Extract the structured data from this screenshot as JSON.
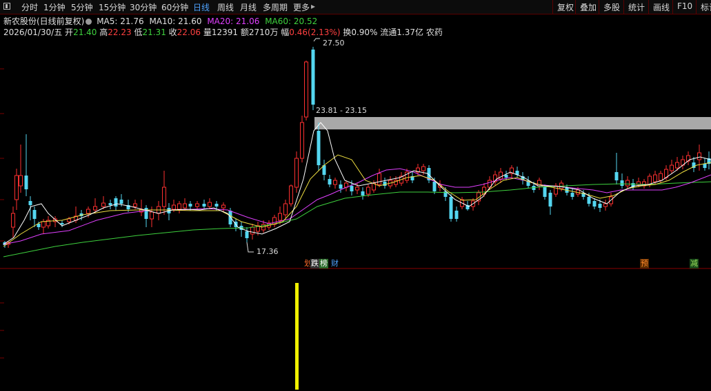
{
  "toolbar": {
    "menu_icon": "panel-toggle-icon",
    "periods": [
      "分时",
      "1分钟",
      "5分钟",
      "15分钟",
      "30分钟",
      "60分钟",
      "日线",
      "周线",
      "月线",
      "多周期",
      "更多"
    ],
    "active_period": "日线",
    "more_arrow": "▸",
    "right_buttons": [
      "复权",
      "叠加",
      "多股",
      "统计",
      "画线",
      "F10",
      "标记"
    ]
  },
  "header": {
    "stock_name": "新农股份(日线前复权)",
    "ma5": "MA5: 21.76",
    "ma10": "MA10: 21.60",
    "ma20": "MA20: 21.06",
    "ma60": "MA60: 20.52",
    "date": "2026/01/30/五",
    "open_label": "开",
    "open": "21.40",
    "high_label": "高",
    "high": "22.23",
    "low_label": "低",
    "low": "21.31",
    "close_label": "收",
    "close": "22.06",
    "volume_label": "量",
    "volume": "12391",
    "amount_label": "额",
    "amount": "2710万",
    "change_label": "幅",
    "change": "0.46(2.13%)",
    "turnover": "换0.90%",
    "float_cap": "流通1.37亿",
    "sector": "农药"
  },
  "annotations": {
    "high_label": "27.50",
    "low_label": "17.36",
    "band_label": "23.81 - 23.15"
  },
  "badges": [
    {
      "text": "划",
      "color": "#ff6a2a"
    },
    {
      "text": "跌",
      "color": "#ffffff",
      "bg": "#333"
    },
    {
      "text": "榜",
      "color": "#ffffff",
      "bg": "#2a6a2a"
    },
    {
      "text": "财",
      "color": "#4fa3ff"
    },
    {
      "text": "预",
      "color": "#ff8a2a",
      "bg": "#5a2a00"
    },
    {
      "text": "减",
      "color": "#9ae05a",
      "bg": "#1a4a1a"
    }
  ],
  "colors": {
    "up": "#ff3030",
    "down": "#54d6f0",
    "ma5": "#ffffff",
    "ma10": "#f0e040",
    "ma20": "#e040ff",
    "ma60": "#3ed23e",
    "volume_bar": "#f0f000",
    "band": "#a8a8a8"
  },
  "volume_bar_icon": "volume-bar"
}
